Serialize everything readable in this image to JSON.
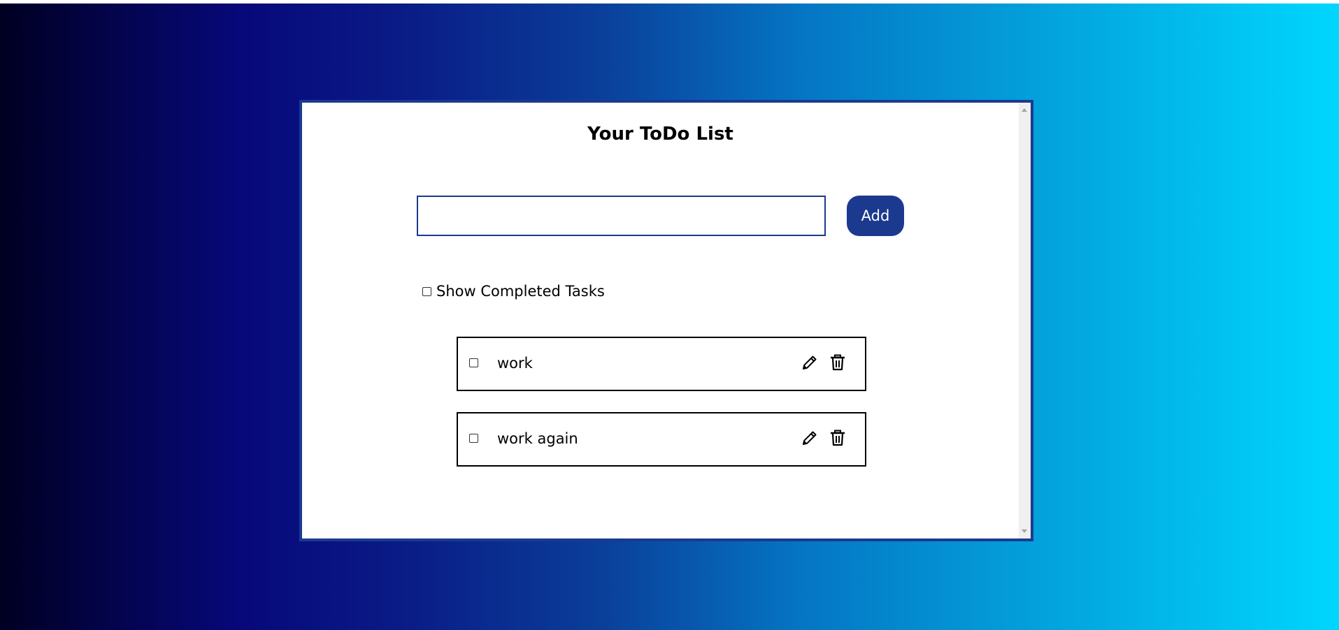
{
  "app": {
    "title": "Your ToDo List"
  },
  "new_task": {
    "value": "",
    "placeholder": "",
    "add_label": "Add"
  },
  "filter": {
    "show_completed_label": "Show Completed Tasks",
    "show_completed_checked": false
  },
  "todos": [
    {
      "text": "work",
      "completed": false,
      "edit_icon": "pencil-icon",
      "delete_icon": "trash-icon"
    },
    {
      "text": "work again",
      "completed": false,
      "edit_icon": "pencil-icon",
      "delete_icon": "trash-icon"
    }
  ],
  "colors": {
    "accent": "#1b3a8f",
    "gradient_start": "#000022",
    "gradient_end": "#00d6fe"
  }
}
